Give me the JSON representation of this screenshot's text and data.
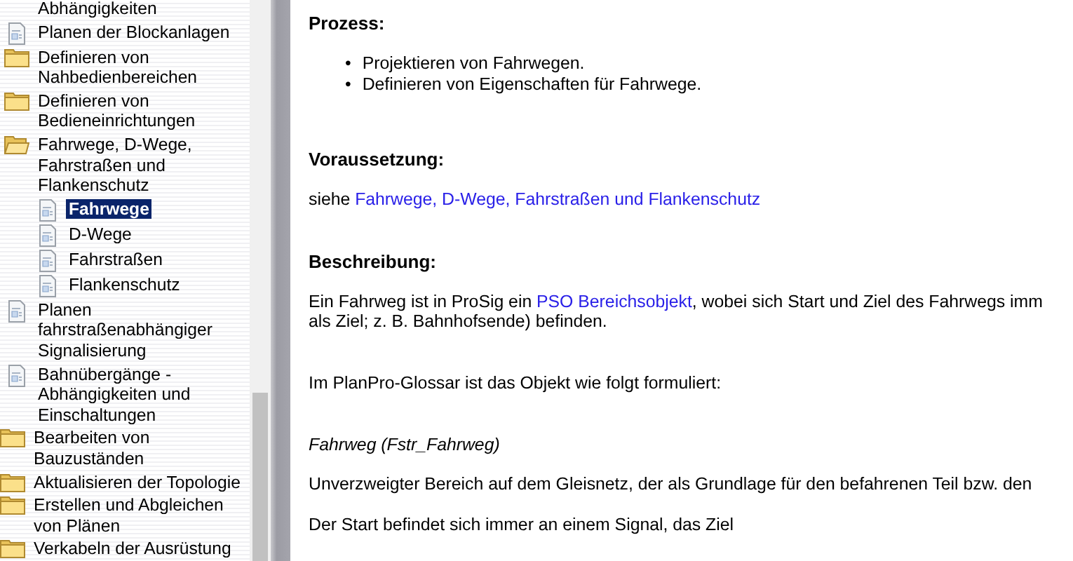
{
  "tree": {
    "items": [
      {
        "label": "Abhängigkeiten",
        "kind": "continued",
        "selected": false
      },
      {
        "label": "Planen der Blockanlagen",
        "kind": "page",
        "selected": false
      },
      {
        "label": "Definieren von Nahbedienbereichen",
        "kind": "folder",
        "expanded": false,
        "selected": false
      },
      {
        "label": "Definieren von Bedieneinrichtungen",
        "kind": "folder",
        "expanded": false,
        "selected": false
      },
      {
        "label": "Fahrwege, D-Wege, Fahrstraßen und Flankenschutz",
        "kind": "folder",
        "expanded": true,
        "selected": false,
        "children": [
          {
            "label": "Fahrwege",
            "kind": "page",
            "selected": true
          },
          {
            "label": "D-Wege",
            "kind": "page",
            "selected": false
          },
          {
            "label": "Fahrstraßen",
            "kind": "page",
            "selected": false
          },
          {
            "label": "Flankenschutz",
            "kind": "page",
            "selected": false
          }
        ]
      },
      {
        "label": "Planen fahrstraßenabhängiger Signalisierung",
        "kind": "page",
        "selected": false
      },
      {
        "label": "Bahnübergänge - Abhängigkeiten und Einschaltungen",
        "kind": "page",
        "selected": false
      }
    ],
    "outer_items": [
      {
        "label": "Bearbeiten von Bauzuständen",
        "kind": "folder",
        "expanded": false,
        "selected": false
      },
      {
        "label": "Aktualisieren der Topologie",
        "kind": "folder",
        "expanded": false,
        "selected": false
      },
      {
        "label": "Erstellen und Abgleichen von Plänen",
        "kind": "folder",
        "expanded": false,
        "selected": false
      },
      {
        "label": "Verkabeln der Ausrüstung",
        "kind": "folder",
        "expanded": false,
        "selected": false
      }
    ]
  },
  "content": [
    {
      "kind": "heading",
      "text": "Prozess:"
    },
    {
      "kind": "list",
      "items": [
        {
          "marker": "•",
          "text": "Projektieren von Fahrwegen."
        },
        {
          "marker": "•",
          "text": "Definieren von Eigenschaften für Fahrwege."
        }
      ]
    },
    {
      "kind": "heading",
      "text": "Voraussetzung:"
    },
    {
      "kind": "paragraph",
      "lines": [
        [
          {
            "text": "siehe "
          },
          {
            "link": "Fahrwege, D-Wege, Fahrstraßen und Flankenschutz"
          }
        ]
      ]
    },
    {
      "kind": "heading",
      "text": "Beschreibung:"
    },
    {
      "kind": "paragraph",
      "lines": [
        [
          {
            "text": "Ein Fahrweg ist in ProSig ein "
          },
          {
            "link": "PSO Bereichsobjekt"
          },
          {
            "text": ", wobei sich Start und Ziel des Fahrwegs imm"
          }
        ],
        [
          {
            "text": "als Ziel; z. B. Bahnhofsende) befinden."
          }
        ]
      ]
    },
    {
      "kind": "paragraph",
      "lines": [
        [
          {
            "text": "Im PlanPro-Glossar ist das Objekt wie folgt formuliert:"
          }
        ]
      ]
    },
    {
      "kind": "term",
      "text": "Fahrweg (Fstr_Fahrweg)"
    },
    {
      "kind": "paragraph",
      "lines": [
        [
          {
            "text": "Unverzweigter Bereich auf dem Gleisnetz, der als Grundlage für den befahrenen Teil bzw. den"
          }
        ]
      ]
    },
    {
      "kind": "paragraph",
      "lines": [
        [
          {
            "text": "Der Start befindet sich immer an einem Signal, das Ziel"
          }
        ]
      ]
    }
  ]
}
